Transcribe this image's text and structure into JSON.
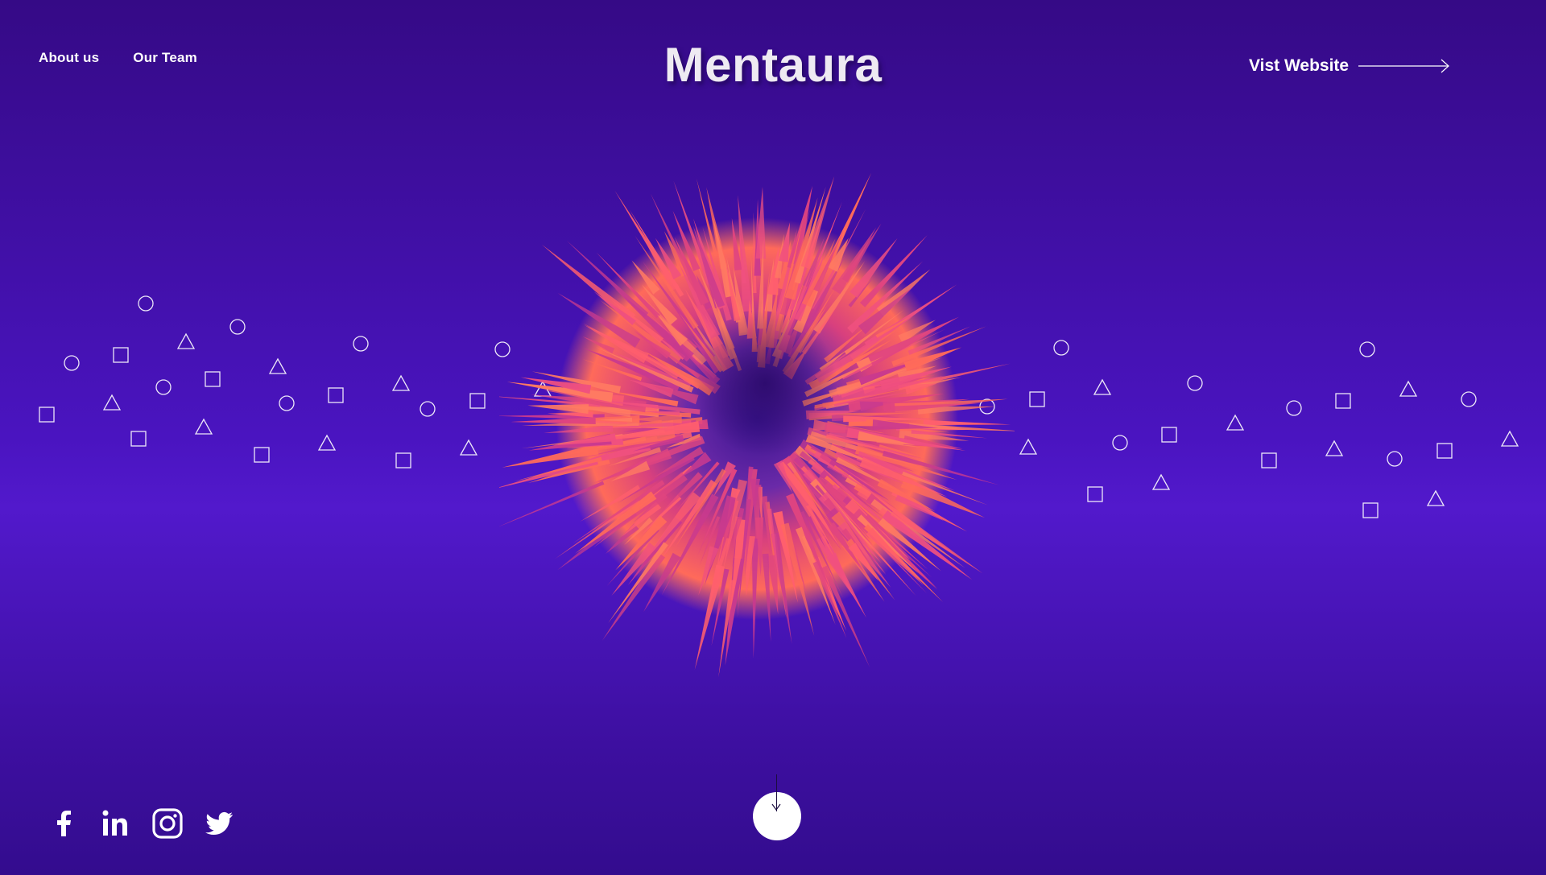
{
  "nav": {
    "about": "About us",
    "team": "Our Team"
  },
  "brand": {
    "title": "Mentaura"
  },
  "cta": {
    "visit": "Vist Website"
  },
  "colors": {
    "background_top": "#350a86",
    "background_mid": "#5219cc",
    "ball_primary": "#ff6a5a",
    "ball_secondary": "#e0457f",
    "ball_core": "#4a1ba8"
  },
  "social": [
    {
      "name": "facebook-icon"
    },
    {
      "name": "linkedin-icon"
    },
    {
      "name": "instagram-icon"
    },
    {
      "name": "twitter-icon"
    }
  ],
  "scroll": {
    "icon": "arrow-down-icon"
  }
}
